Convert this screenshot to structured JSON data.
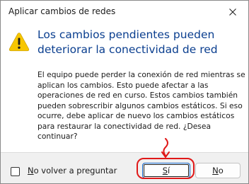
{
  "window": {
    "title": "Aplicar cambios de redes",
    "close_icon": "close-icon"
  },
  "message": {
    "icon": "warning-icon",
    "heading_lines": [
      "Los cambios pendientes pueden",
      "deteriorar la conectividad de red"
    ],
    "body_lines": [
      "El equipo puede perder la conexión de red mientras se",
      "aplican los cambios. Esto puede afectar a las",
      "operaciones de red en curso. Estos cambios también",
      "pueden sobrescribir algunos cambios estáticos. Si eso",
      "ocurre, debe aplicar de nuevo los cambios estáticos",
      "para restaurar la conectividad de red. ¿Desea",
      "continuar?"
    ]
  },
  "footer": {
    "checkbox": {
      "label_first": "N",
      "label_rest": "o volver a preguntar",
      "checked": false
    },
    "yes_button": {
      "label_first": "S",
      "label_rest": "í"
    },
    "no_button": {
      "label_first": "N",
      "label_rest": "o"
    }
  },
  "annotation": {
    "color": "#e01818"
  },
  "colors": {
    "heading": "#0a3e8f",
    "warning_fill": "#f7c600",
    "focus_border": "#0f64c8"
  }
}
